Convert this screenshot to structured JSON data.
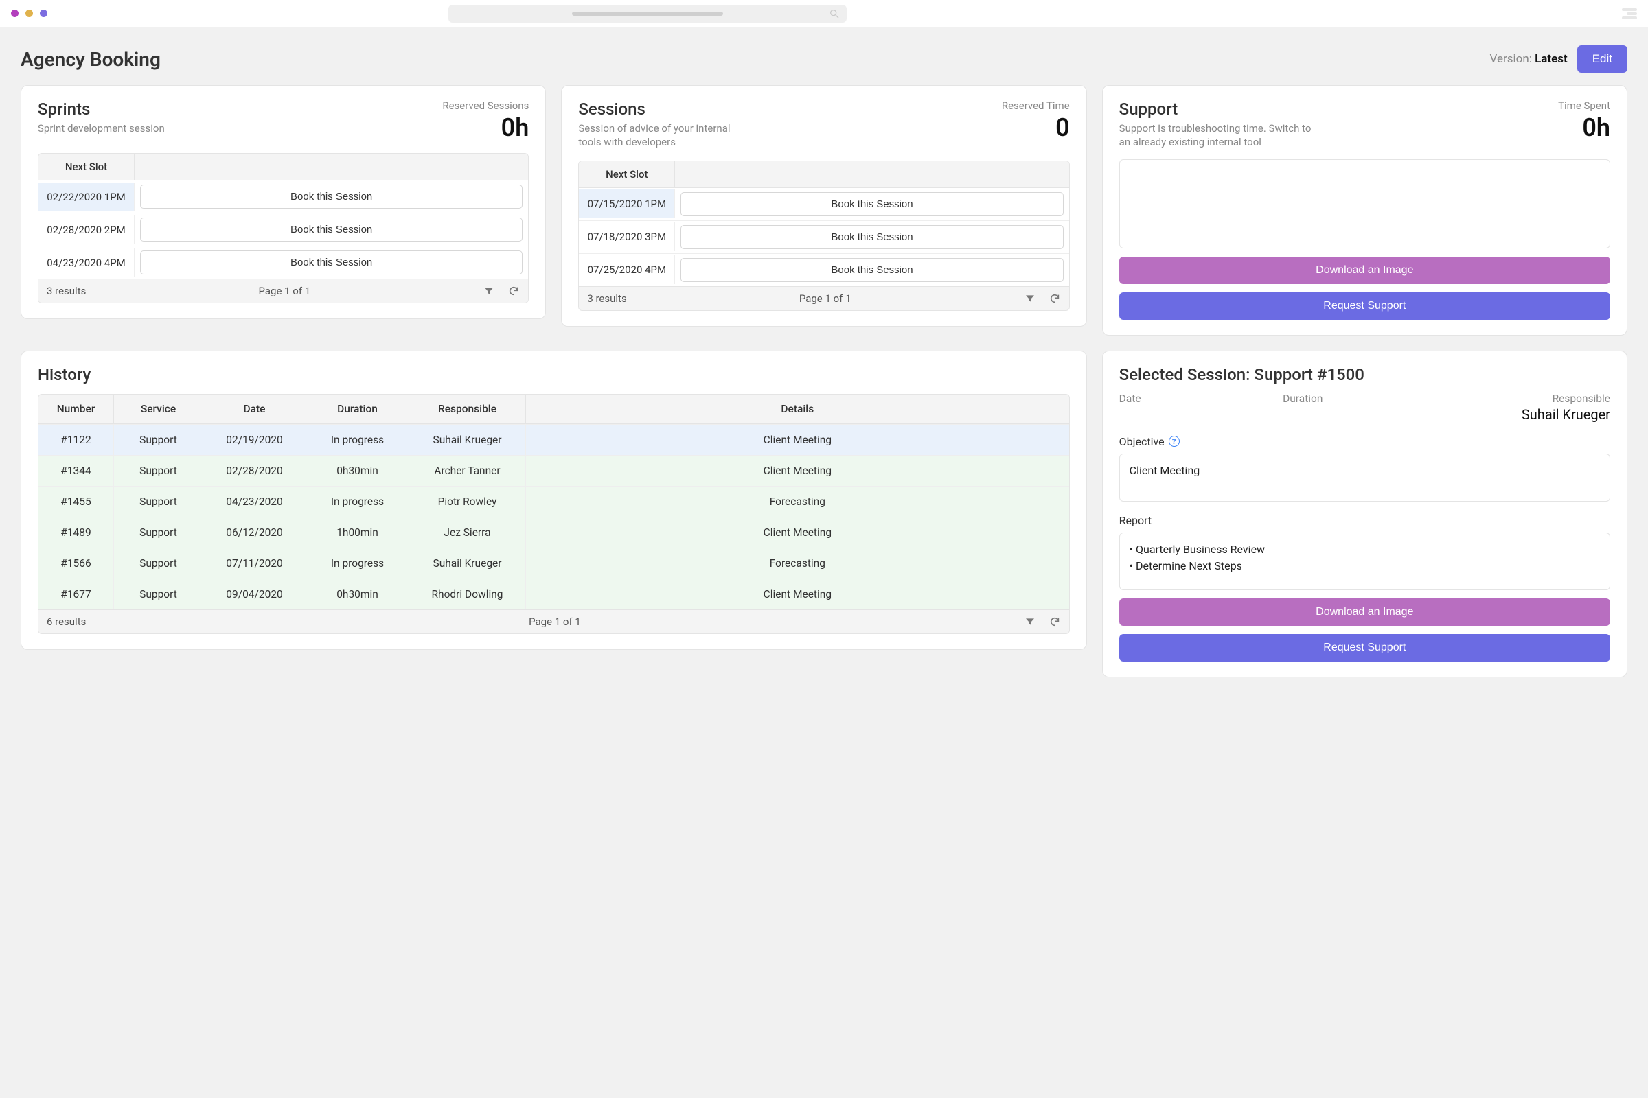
{
  "header": {
    "page_title": "Agency Booking",
    "version_label": "Version: ",
    "version_value": "Latest",
    "edit_label": "Edit"
  },
  "sprints": {
    "title": "Sprints",
    "subtitle": "Sprint development session",
    "metric_label": "Reserved Sessions",
    "metric_value": "0h",
    "next_slot_header": "Next Slot",
    "book_label": "Book this Session",
    "slots": [
      {
        "when": "02/22/2020 1PM",
        "selected": true
      },
      {
        "when": "02/28/2020 2PM",
        "selected": false
      },
      {
        "when": "04/23/2020 4PM",
        "selected": false
      }
    ],
    "results_text": "3 results",
    "pager_text": "Page 1 of 1"
  },
  "sessions": {
    "title": "Sessions",
    "subtitle": "Session of advice of your internal tools with developers",
    "metric_label": "Reserved Time",
    "metric_value": "0",
    "next_slot_header": "Next Slot",
    "book_label": "Book this Session",
    "slots": [
      {
        "when": "07/15/2020 1PM",
        "selected": true
      },
      {
        "when": "07/18/2020 3PM",
        "selected": false
      },
      {
        "when": "07/25/2020 4PM",
        "selected": false
      }
    ],
    "results_text": "3 results",
    "pager_text": "Page 1 of 1"
  },
  "support": {
    "title": "Support",
    "subtitle": "Support is troubleshooting time. Switch to an already existing internal tool",
    "metric_label": "Time Spent",
    "metric_value": "0h",
    "download_label": "Download an Image",
    "request_label": "Request Support"
  },
  "history": {
    "title": "History",
    "columns": [
      "Number",
      "Service",
      "Date",
      "Duration",
      "Responsible",
      "Details"
    ],
    "rows": [
      {
        "number": "#1122",
        "service": "Support",
        "date": "02/19/2020",
        "duration": "In progress",
        "responsible": "Suhail Krueger",
        "details": "Client Meeting",
        "state": "selected"
      },
      {
        "number": "#1344",
        "service": "Support",
        "date": "02/28/2020",
        "duration": "0h30min",
        "responsible": "Archer Tanner",
        "details": "Client Meeting",
        "state": "done"
      },
      {
        "number": "#1455",
        "service": "Support",
        "date": "04/23/2020",
        "duration": "In progress",
        "responsible": "Piotr Rowley",
        "details": "Forecasting",
        "state": "done"
      },
      {
        "number": "#1489",
        "service": "Support",
        "date": "06/12/2020",
        "duration": "1h00min",
        "responsible": "Jez Sierra",
        "details": "Client Meeting",
        "state": "done"
      },
      {
        "number": "#1566",
        "service": "Support",
        "date": "07/11/2020",
        "duration": "In progress",
        "responsible": "Suhail Krueger",
        "details": "Forecasting",
        "state": "done"
      },
      {
        "number": "#1677",
        "service": "Support",
        "date": "09/04/2020",
        "duration": "0h30min",
        "responsible": "Rhodri Dowling",
        "details": "Client Meeting",
        "state": "done"
      }
    ],
    "results_text": "6 results",
    "pager_text": "Page 1 of 1"
  },
  "selected_session": {
    "title": "Selected Session: Support #1500",
    "date_label": "Date",
    "date_value": "",
    "duration_label": "Duration",
    "duration_value": "",
    "responsible_label": "Responsible",
    "responsible_value": "Suhail Krueger",
    "objective_label": "Objective",
    "objective_value": "Client Meeting",
    "report_label": "Report",
    "report_lines": [
      "Quarterly Business Review",
      "Determine Next Steps"
    ],
    "download_label": "Download an Image",
    "request_label": "Request Support"
  }
}
